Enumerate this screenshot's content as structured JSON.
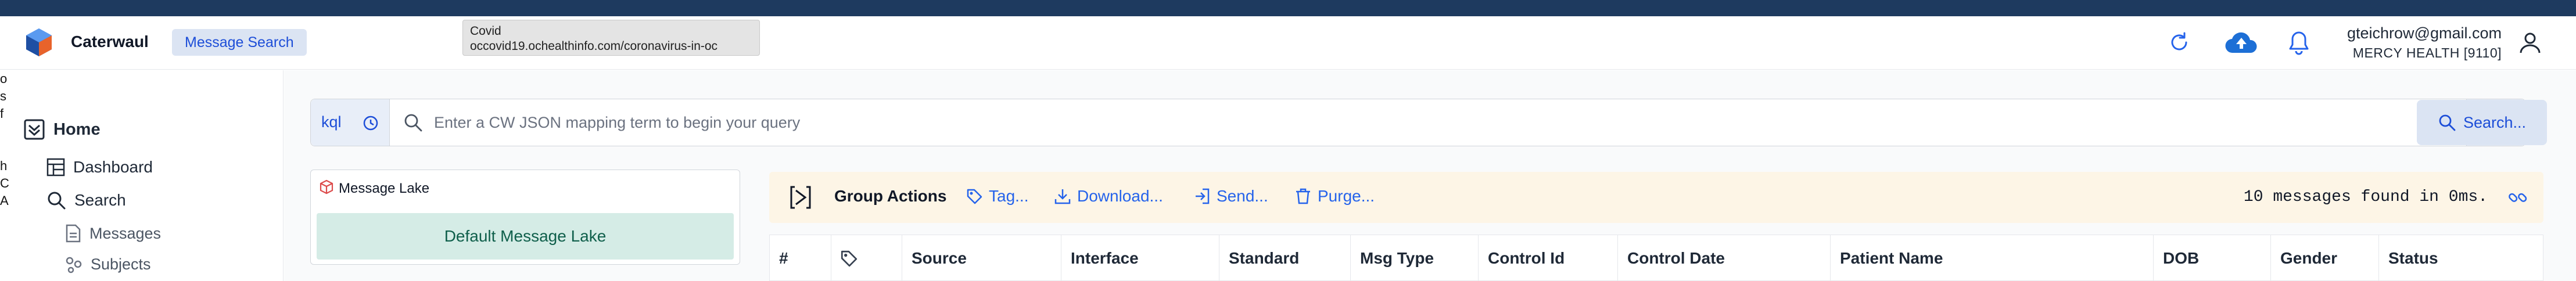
{
  "app": {
    "name": "Caterwaul",
    "badge": "Message Search"
  },
  "tooltip": {
    "title": "Covid",
    "url": "occovid19.ochealthinfo.com/coronavirus-in-oc"
  },
  "user": {
    "email": "gteichrow@gmail.com",
    "org": "MERCY HEALTH [9110]"
  },
  "edge_letters": [
    "o",
    "s",
    "f",
    "",
    "",
    "h",
    "C",
    "A"
  ],
  "sidebar": {
    "home": "Home",
    "dashboard": "Dashboard",
    "search": "Search",
    "messages": "Messages",
    "subjects": "Subjects"
  },
  "query": {
    "mode": "kql",
    "placeholder": "Enter a CW JSON mapping term to begin your query",
    "search_button": "Search..."
  },
  "lake": {
    "title": "Message Lake",
    "default": "Default Message Lake"
  },
  "actions": {
    "title": "Group Actions",
    "tag": "Tag...",
    "download": "Download...",
    "send": "Send...",
    "purge": "Purge...",
    "found": "10 messages found in 0ms."
  },
  "table": {
    "columns": [
      "#",
      "",
      "Source",
      "Interface",
      "Standard",
      "Msg Type",
      "Control Id",
      "Control Date",
      "Patient Name",
      "DOB",
      "Gender",
      "Status"
    ]
  },
  "colors": {
    "accent": "#2563eb",
    "brand_blue": "#1d4ed8",
    "lake_green": "#d5ece6",
    "actions_bg": "#fdf5e6"
  }
}
